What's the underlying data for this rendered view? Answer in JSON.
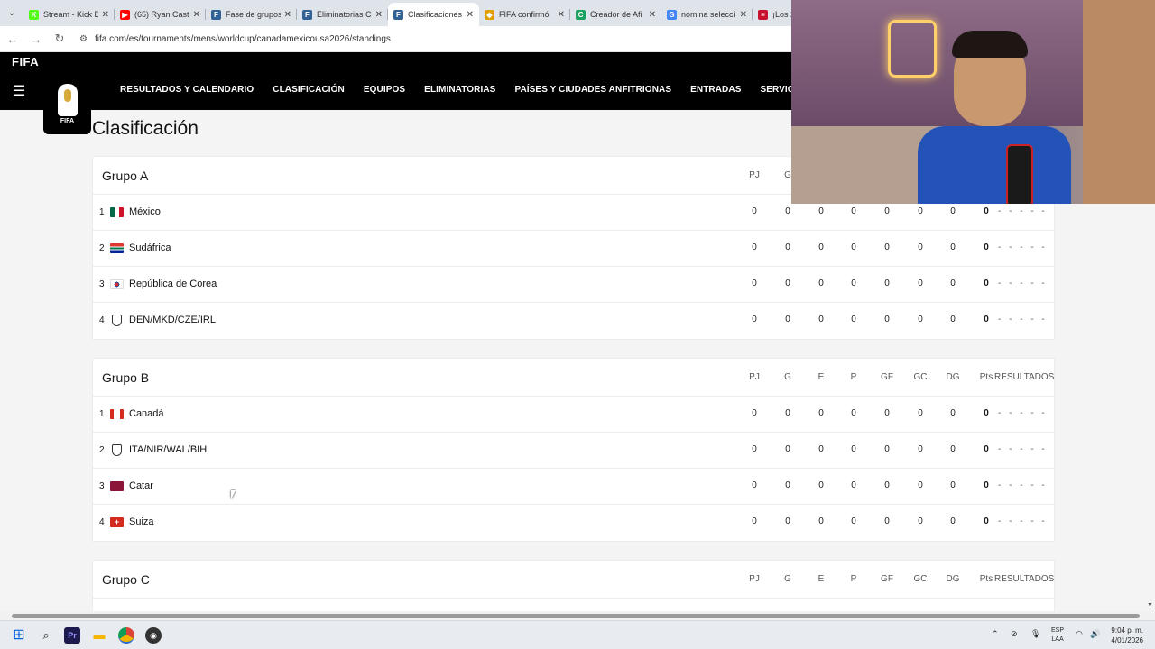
{
  "browser": {
    "tabs": [
      {
        "title": "Stream - Kick D",
        "icon_color": "#53fc18",
        "icon": "K",
        "active": false
      },
      {
        "title": "(65) Ryan Castr",
        "icon_color": "#ff0000",
        "icon": "▶",
        "active": false
      },
      {
        "title": "Fase de grupos",
        "icon_color": "#326295",
        "icon": "F",
        "active": false
      },
      {
        "title": "Eliminatorias C",
        "icon_color": "#326295",
        "icon": "F",
        "active": false
      },
      {
        "title": "Clasificaciones",
        "icon_color": "#326295",
        "icon": "F",
        "active": true
      },
      {
        "title": "FIFA confirmó",
        "icon_color": "#e0a100",
        "icon": "◆",
        "active": false
      },
      {
        "title": "Creador de Afi",
        "icon_color": "#1aa260",
        "icon": "C",
        "active": false
      },
      {
        "title": "nomina selecci",
        "icon_color": "#4285f4",
        "icon": "G",
        "active": false
      },
      {
        "title": "¡Los 26",
        "icon_color": "#c8102e",
        "icon": "≡",
        "active": false
      }
    ],
    "url": "fifa.com/es/tournaments/mens/worldcup/canadamexicousa2026/standings"
  },
  "site": {
    "logo": "FIFA",
    "badge_text": "FIFA",
    "menu": [
      "RESULTADOS Y CALENDARIO",
      "CLASIFICACIÓN",
      "EQUIPOS",
      "ELIMINATORIAS",
      "PAÍSES Y CIUDADES ANFITRIONAS",
      "ENTRADAS",
      "SERVICIOS PREFEREN"
    ]
  },
  "page_title": "Clasificación",
  "columns": [
    "PJ",
    "G",
    "E",
    "P",
    "GF",
    "GC",
    "DG",
    "Pts",
    "RESULTADOS"
  ],
  "results_placeholder": "- - - - -",
  "groups": [
    {
      "name": "Grupo A",
      "teams": [
        {
          "pos": "1",
          "name": "México",
          "flag": "mx",
          "stats": [
            "0",
            "0",
            "0",
            "0",
            "0",
            "0",
            "0",
            "0"
          ]
        },
        {
          "pos": "2",
          "name": "Sudáfrica",
          "flag": "za",
          "stats": [
            "0",
            "0",
            "0",
            "0",
            "0",
            "0",
            "0",
            "0"
          ]
        },
        {
          "pos": "3",
          "name": "República de Corea",
          "flag": "kr",
          "stats": [
            "0",
            "0",
            "0",
            "0",
            "0",
            "0",
            "0",
            "0"
          ]
        },
        {
          "pos": "4",
          "name": "DEN/MKD/CZE/IRL",
          "flag": "shield",
          "stats": [
            "0",
            "0",
            "0",
            "0",
            "0",
            "0",
            "0",
            "0"
          ]
        }
      ]
    },
    {
      "name": "Grupo B",
      "teams": [
        {
          "pos": "1",
          "name": "Canadá",
          "flag": "ca",
          "stats": [
            "0",
            "0",
            "0",
            "0",
            "0",
            "0",
            "0",
            "0"
          ]
        },
        {
          "pos": "2",
          "name": "ITA/NIR/WAL/BIH",
          "flag": "shield",
          "stats": [
            "0",
            "0",
            "0",
            "0",
            "0",
            "0",
            "0",
            "0"
          ]
        },
        {
          "pos": "3",
          "name": "Catar",
          "flag": "qa",
          "stats": [
            "0",
            "0",
            "0",
            "0",
            "0",
            "0",
            "0",
            "0"
          ]
        },
        {
          "pos": "4",
          "name": "Suiza",
          "flag": "ch",
          "stats": [
            "0",
            "0",
            "0",
            "0",
            "0",
            "0",
            "0",
            "0"
          ]
        }
      ]
    },
    {
      "name": "Grupo C",
      "teams": []
    }
  ],
  "taskbar": {
    "lang_top": "ESP",
    "lang_bottom": "LAA",
    "time": "9:04 p. m.",
    "date": "4/01/2026"
  }
}
